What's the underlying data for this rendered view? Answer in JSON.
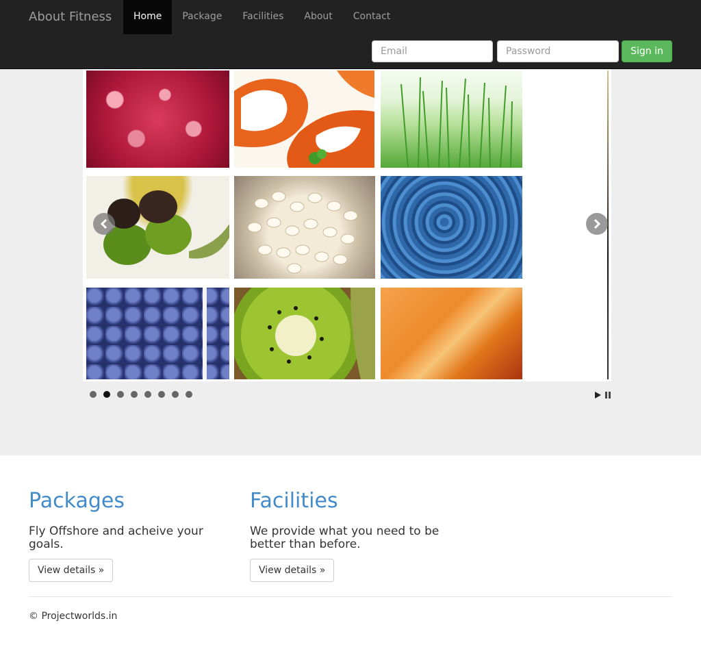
{
  "navbar": {
    "brand": "About Fitness",
    "items": [
      {
        "label": "Home",
        "active": true
      },
      {
        "label": "Package",
        "active": false
      },
      {
        "label": "Facilities",
        "active": false
      },
      {
        "label": "About",
        "active": false
      },
      {
        "label": "Contact",
        "active": false
      }
    ],
    "signin": {
      "email_placeholder": "Email",
      "password_placeholder": "Password",
      "button_label": "Sign in"
    }
  },
  "slider": {
    "images": [
      "raspberries",
      "salmon",
      "wheatgrass",
      "olives",
      "barley",
      "water",
      "blueberries",
      "kiwi",
      "cantaloupe"
    ],
    "dot_count": 8,
    "active_dot": 2,
    "icons": {
      "prev": "chevron-left-icon",
      "next": "chevron-right-icon",
      "play": "play-icon",
      "pause": "pause-icon"
    }
  },
  "columns": [
    {
      "heading": "Packages",
      "text": "Fly Offshore and acheive your goals.",
      "button": "View details »"
    },
    {
      "heading": "Facilities",
      "text": "We provide what you need to be better than before.",
      "button": "View details »"
    }
  ],
  "footer": {
    "text": "© Projectworlds.in"
  },
  "colors": {
    "navbar": "#222222",
    "link": "#428bca",
    "success": "#5cb85c",
    "jumbotron": "#eeeeee"
  }
}
